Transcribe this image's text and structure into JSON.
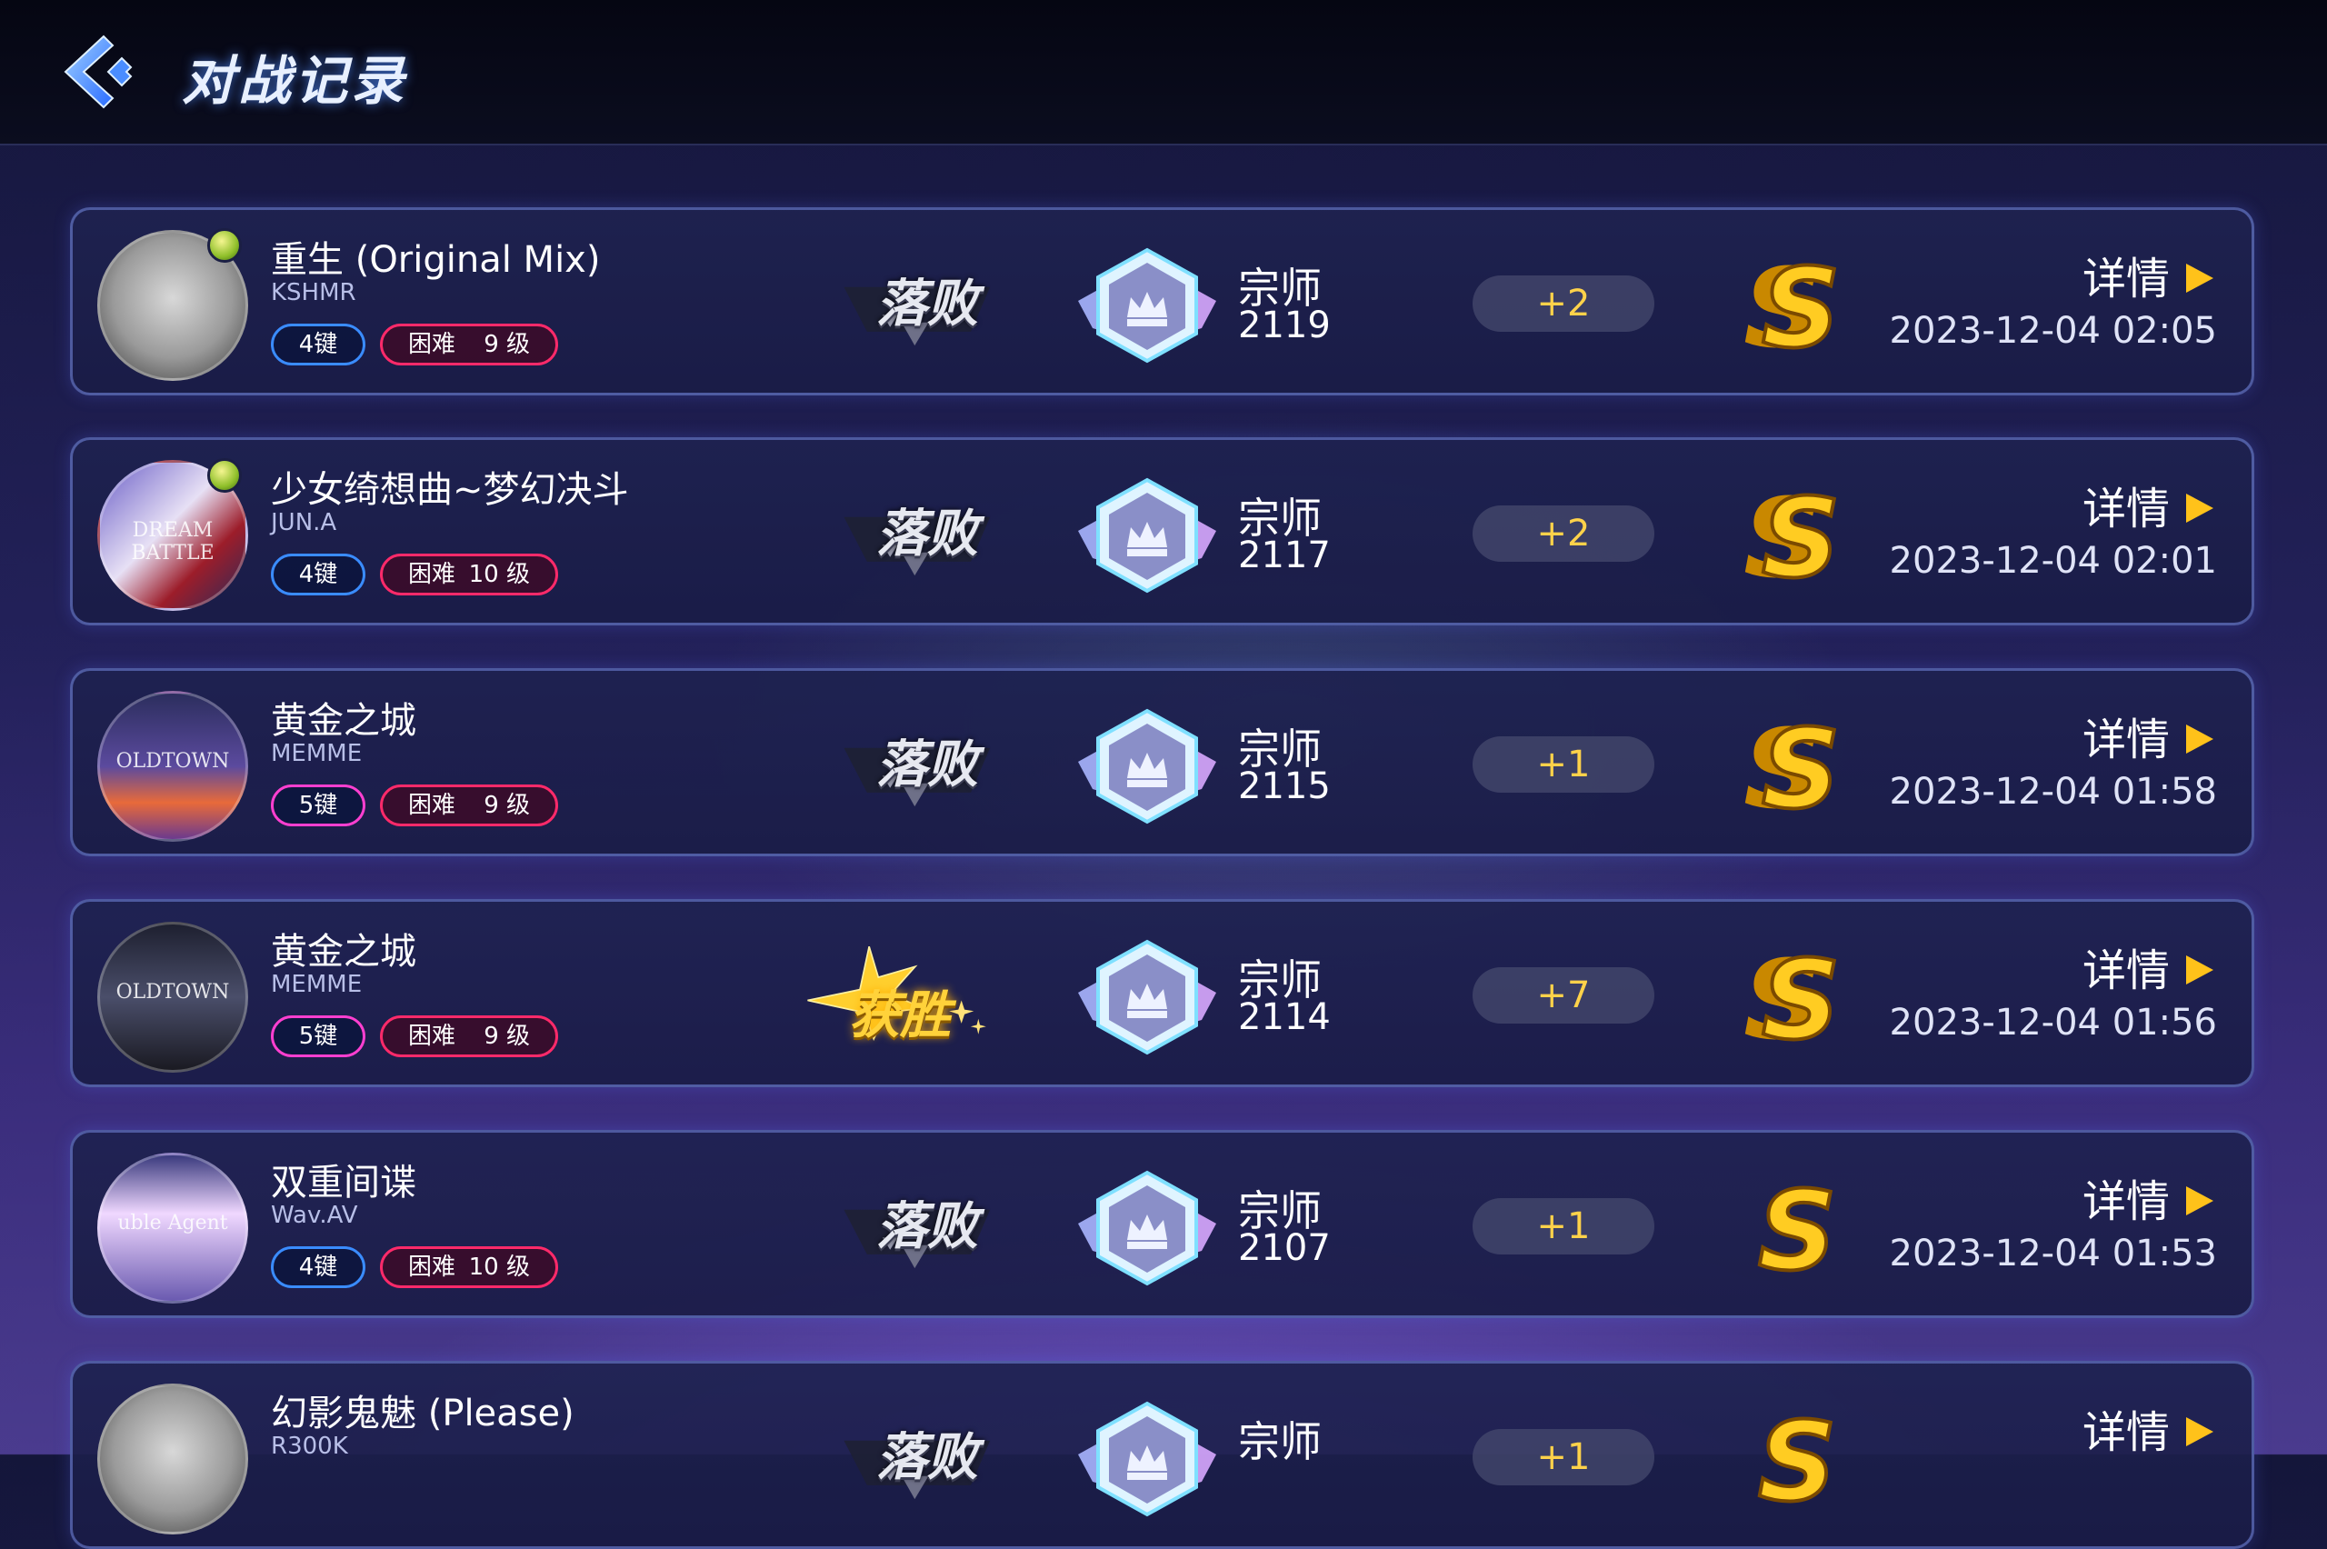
{
  "header": {
    "title": "对战记录"
  },
  "records": [
    {
      "cover_label": "",
      "song": "重生 (Original Mix)",
      "artist": "KSHMR",
      "keys": "4键",
      "key_color": "blue",
      "difficulty": "困难",
      "level": "9 级",
      "medal": true,
      "result": "落败",
      "result_type": "lose",
      "rank": "宗师",
      "score": "2119",
      "delta": "+2",
      "grade": "S",
      "grade_double": true,
      "detail": "详情",
      "time": "2023-12-04 02:05"
    },
    {
      "cover_label": "DREAM BATTLE",
      "song": "少女绮想曲~梦幻决斗",
      "artist": "JUN.A",
      "keys": "4键",
      "key_color": "blue",
      "difficulty": "困难",
      "level": "10 级",
      "medal": true,
      "result": "落败",
      "result_type": "lose",
      "rank": "宗师",
      "score": "2117",
      "delta": "+2",
      "grade": "S",
      "grade_double": true,
      "detail": "详情",
      "time": "2023-12-04 02:01"
    },
    {
      "cover_label": "OLDTOWN",
      "song": "黄金之城",
      "artist": "MEMME",
      "keys": "5键",
      "key_color": "pink",
      "difficulty": "困难",
      "level": "9 级",
      "medal": false,
      "result": "落败",
      "result_type": "lose",
      "rank": "宗师",
      "score": "2115",
      "delta": "+1",
      "grade": "S",
      "grade_double": true,
      "detail": "详情",
      "time": "2023-12-04 01:58"
    },
    {
      "cover_label": "OLDTOWN",
      "song": "黄金之城",
      "artist": "MEMME",
      "keys": "5键",
      "key_color": "pink",
      "difficulty": "困难",
      "level": "9 级",
      "medal": false,
      "result": "获胜",
      "result_type": "win",
      "rank": "宗师",
      "score": "2114",
      "delta": "+7",
      "grade": "S",
      "grade_double": true,
      "detail": "详情",
      "time": "2023-12-04 01:56"
    },
    {
      "cover_label": "uble Agent",
      "song": "双重间谍",
      "artist": "Wav.AV",
      "keys": "4键",
      "key_color": "blue",
      "difficulty": "困难",
      "level": "10 级",
      "medal": false,
      "result": "落败",
      "result_type": "lose",
      "rank": "宗师",
      "score": "2107",
      "delta": "+1",
      "grade": "S",
      "grade_double": false,
      "detail": "详情",
      "time": "2023-12-04 01:53"
    },
    {
      "cover_label": "",
      "song": "幻影鬼魅 (Please)",
      "artist": "R300K",
      "keys": "",
      "key_color": "blue",
      "difficulty": "",
      "level": "",
      "medal": false,
      "result": "落败",
      "result_type": "lose",
      "rank": "宗师",
      "score": "",
      "delta": "+1",
      "grade": "S",
      "grade_double": false,
      "detail": "详情",
      "time": ""
    }
  ]
}
